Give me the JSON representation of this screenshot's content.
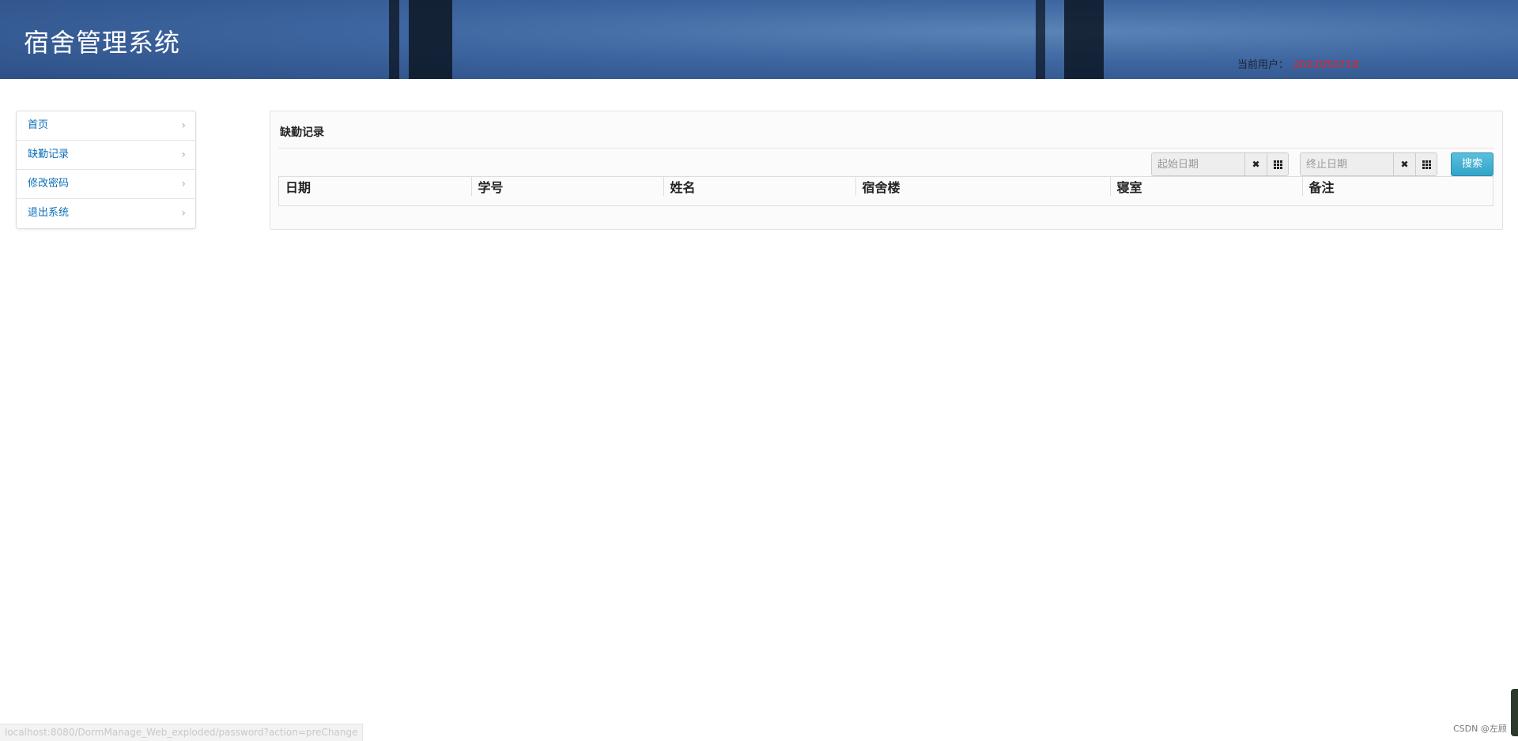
{
  "header": {
    "title": "宿舍管理系统",
    "current_user_label": "当前用户：",
    "current_user_value": "2022050718"
  },
  "sidebar": {
    "items": [
      {
        "label": "首页"
      },
      {
        "label": "缺勤记录"
      },
      {
        "label": "修改密码"
      },
      {
        "label": "退出系统"
      }
    ]
  },
  "panel": {
    "title": "缺勤记录",
    "start_date": {
      "placeholder": "起始日期",
      "value": ""
    },
    "end_date": {
      "placeholder": "终止日期",
      "value": ""
    },
    "search_label": "搜索"
  },
  "table": {
    "columns": [
      "日期",
      "学号",
      "姓名",
      "宿舍楼",
      "寝室",
      "备注"
    ],
    "rows": []
  },
  "status_bar": {
    "url": "localhost:8080/DormManage_Web_exploded/password?action=preChange"
  },
  "watermark": "CSDN @左顾",
  "colors": {
    "header_bg": "#3e66a0",
    "link": "#0b6eb8",
    "user_value": "#e0242a",
    "search_button": "#31a4c9"
  },
  "icons": {
    "clear": "close-icon",
    "calendar": "grid-icon",
    "chevron": "chevron-right-icon"
  }
}
